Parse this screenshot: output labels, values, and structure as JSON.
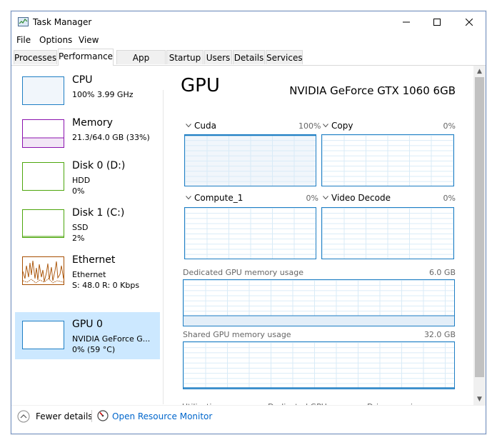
{
  "window": {
    "title": "Task Manager",
    "controls": {
      "minimize": "—",
      "maximize": "☐",
      "close": "✕"
    }
  },
  "menu": [
    "File",
    "Options",
    "View"
  ],
  "tabs": [
    "Processes",
    "Performance",
    "App history",
    "Startup",
    "Users",
    "Details",
    "Services"
  ],
  "active_tab": "Performance",
  "sidebar": {
    "items": [
      {
        "title": "CPU",
        "line1": "100% 3.99 GHz",
        "line2": "",
        "color": "#1e7ec4"
      },
      {
        "title": "Memory",
        "line1": "21.3/64.0 GB (33%)",
        "line2": "",
        "color": "#8b12ae"
      },
      {
        "title": "Disk 0 (D:)",
        "line1": "HDD",
        "line2": "0%",
        "color": "#4da60c"
      },
      {
        "title": "Disk 1 (C:)",
        "line1": "SSD",
        "line2": "2%",
        "color": "#4da60c"
      },
      {
        "title": "Ethernet",
        "line1": "Ethernet",
        "line2": "S: 48.0  R: 0 Kbps",
        "color": "#a74f01"
      },
      {
        "title": "GPU 0",
        "line1": "NVIDIA GeForce G...",
        "line2": "0% (59 °C)",
        "color": "#1e7ec4"
      }
    ],
    "selected": "GPU 0"
  },
  "gpu": {
    "title": "GPU",
    "model": "NVIDIA GeForce GTX 1060 6GB",
    "engines": [
      {
        "name": "Cuda",
        "percent": "100%"
      },
      {
        "name": "Copy",
        "percent": "0%"
      },
      {
        "name": "Compute_1",
        "percent": "0%"
      },
      {
        "name": "Video Decode",
        "percent": "0%"
      }
    ],
    "dedicated_label": "Dedicated GPU memory usage",
    "dedicated_max": "6.0 GB",
    "shared_label": "Shared GPU memory usage",
    "shared_max": "32.0 GB",
    "stats": {
      "utilization": "Utilization",
      "dedicated_memory": "Dedicated GPU memory",
      "driver_version": "Driver version:"
    }
  },
  "footer": {
    "fewer_details": "Fewer details",
    "open_resource_monitor": "Open Resource Monitor"
  }
}
